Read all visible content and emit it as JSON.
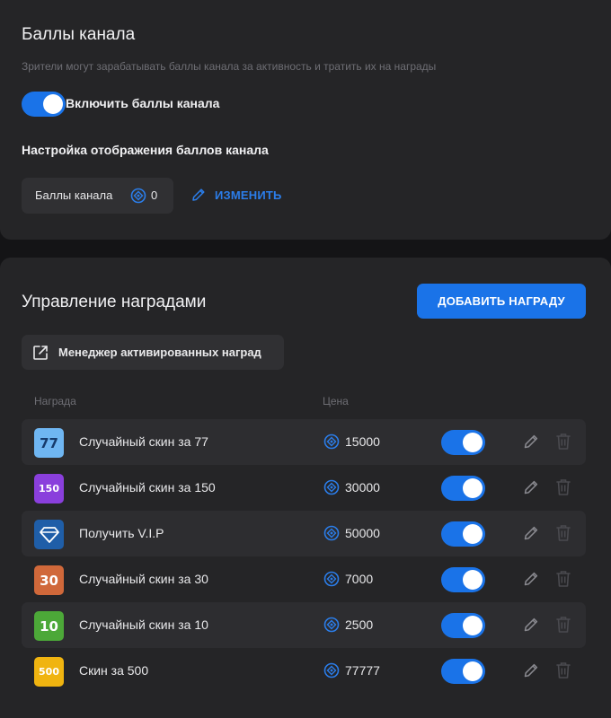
{
  "channel_points": {
    "title": "Баллы канала",
    "description": "Зрители могут зарабатывать баллы канала за активность и тратить их на награды",
    "enable_label": "Включить баллы канала",
    "enabled": true,
    "display_settings_title": "Настройка отображения баллов канала",
    "points_label": "Баллы канала",
    "points_value": "0",
    "edit_label": "ИЗМЕНИТЬ"
  },
  "rewards": {
    "title": "Управление наградами",
    "add_button": "ДОБАВИТЬ НАГРАДУ",
    "manager_button": "Менеджер активированных наград",
    "columns": {
      "reward": "Награда",
      "price": "Цена"
    },
    "items": [
      {
        "name": "Случайный скин за 77",
        "price": "15000",
        "badge": "77",
        "badge_color": "#6fb6f2",
        "badge_text_color": "#163a6b",
        "enabled": true
      },
      {
        "name": "Случайный скин за 150",
        "price": "30000",
        "badge": "150",
        "badge_color": "#8a3fdc",
        "badge_text_color": "#ffffff",
        "enabled": true
      },
      {
        "name": "Получить V.I.P",
        "price": "50000",
        "badge": "diamond-icon",
        "badge_color": "#1f5ea8",
        "badge_text_color": "#ffffff",
        "enabled": true
      },
      {
        "name": "Случайный скин за 30",
        "price": "7000",
        "badge": "30",
        "badge_color": "#d0683a",
        "badge_text_color": "#ffffff",
        "enabled": true
      },
      {
        "name": "Случайный скин за 10",
        "price": "2500",
        "badge": "10",
        "badge_color": "#4ca838",
        "badge_text_color": "#ffffff",
        "enabled": true
      },
      {
        "name": "Скин за 500",
        "price": "77777",
        "badge": "500",
        "badge_color": "#f0b410",
        "badge_text_color": "#ffffff",
        "enabled": true
      }
    ]
  },
  "colors": {
    "accent": "#1a73e8",
    "link": "#2b7de9",
    "card_bg": "#252527",
    "page_bg": "#141416"
  }
}
